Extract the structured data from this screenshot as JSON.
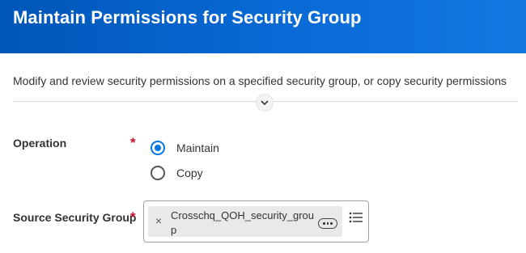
{
  "header": {
    "title": "Maintain Permissions for Security Group"
  },
  "description": "Modify and review security permissions on a specified security group, or copy security permissions",
  "operation": {
    "label": "Operation",
    "required_mark": "*",
    "options": [
      {
        "label": "Maintain",
        "selected": true
      },
      {
        "label": "Copy",
        "selected": false
      }
    ]
  },
  "source_security_group": {
    "label": "Source Security Group",
    "required_mark": "*",
    "selected_value": "Crosschq_QOH_security_group",
    "remove_glyph": "×"
  },
  "colors": {
    "header_blue": "#0056b8",
    "radio_accent": "#0875e1",
    "required_red": "#c8102e"
  },
  "icons": {
    "expand": "chevron-down-icon",
    "remove": "close-icon",
    "more": "more-options-icon",
    "prompt": "list-icon"
  }
}
